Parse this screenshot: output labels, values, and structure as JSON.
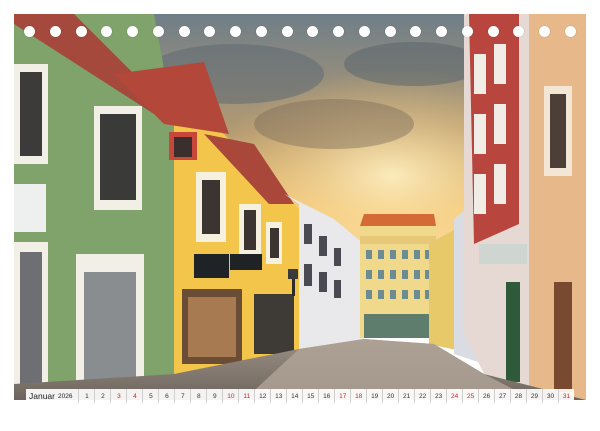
{
  "calendar": {
    "month": "Januar",
    "year": "2026",
    "days": [
      {
        "n": "1",
        "we": false
      },
      {
        "n": "2",
        "we": false
      },
      {
        "n": "3",
        "we": true
      },
      {
        "n": "4",
        "we": true
      },
      {
        "n": "5",
        "we": false
      },
      {
        "n": "6",
        "we": false
      },
      {
        "n": "7",
        "we": false
      },
      {
        "n": "8",
        "we": false
      },
      {
        "n": "9",
        "we": false
      },
      {
        "n": "10",
        "we": true
      },
      {
        "n": "11",
        "we": true
      },
      {
        "n": "12",
        "we": false
      },
      {
        "n": "13",
        "we": false
      },
      {
        "n": "14",
        "we": false
      },
      {
        "n": "15",
        "we": false
      },
      {
        "n": "16",
        "we": false
      },
      {
        "n": "17",
        "we": true
      },
      {
        "n": "18",
        "we": true
      },
      {
        "n": "19",
        "we": false
      },
      {
        "n": "20",
        "we": false
      },
      {
        "n": "21",
        "we": false
      },
      {
        "n": "22",
        "we": false
      },
      {
        "n": "23",
        "we": false
      },
      {
        "n": "24",
        "we": true
      },
      {
        "n": "25",
        "we": true
      },
      {
        "n": "26",
        "we": false
      },
      {
        "n": "27",
        "we": false
      },
      {
        "n": "28",
        "we": false
      },
      {
        "n": "29",
        "we": false
      },
      {
        "n": "30",
        "we": false
      },
      {
        "n": "31",
        "we": true
      }
    ]
  },
  "colors": {
    "weekend": "#c62828",
    "weekday": "#333333",
    "binding_hole": "#ffffff"
  },
  "binding_hole_count": 22
}
